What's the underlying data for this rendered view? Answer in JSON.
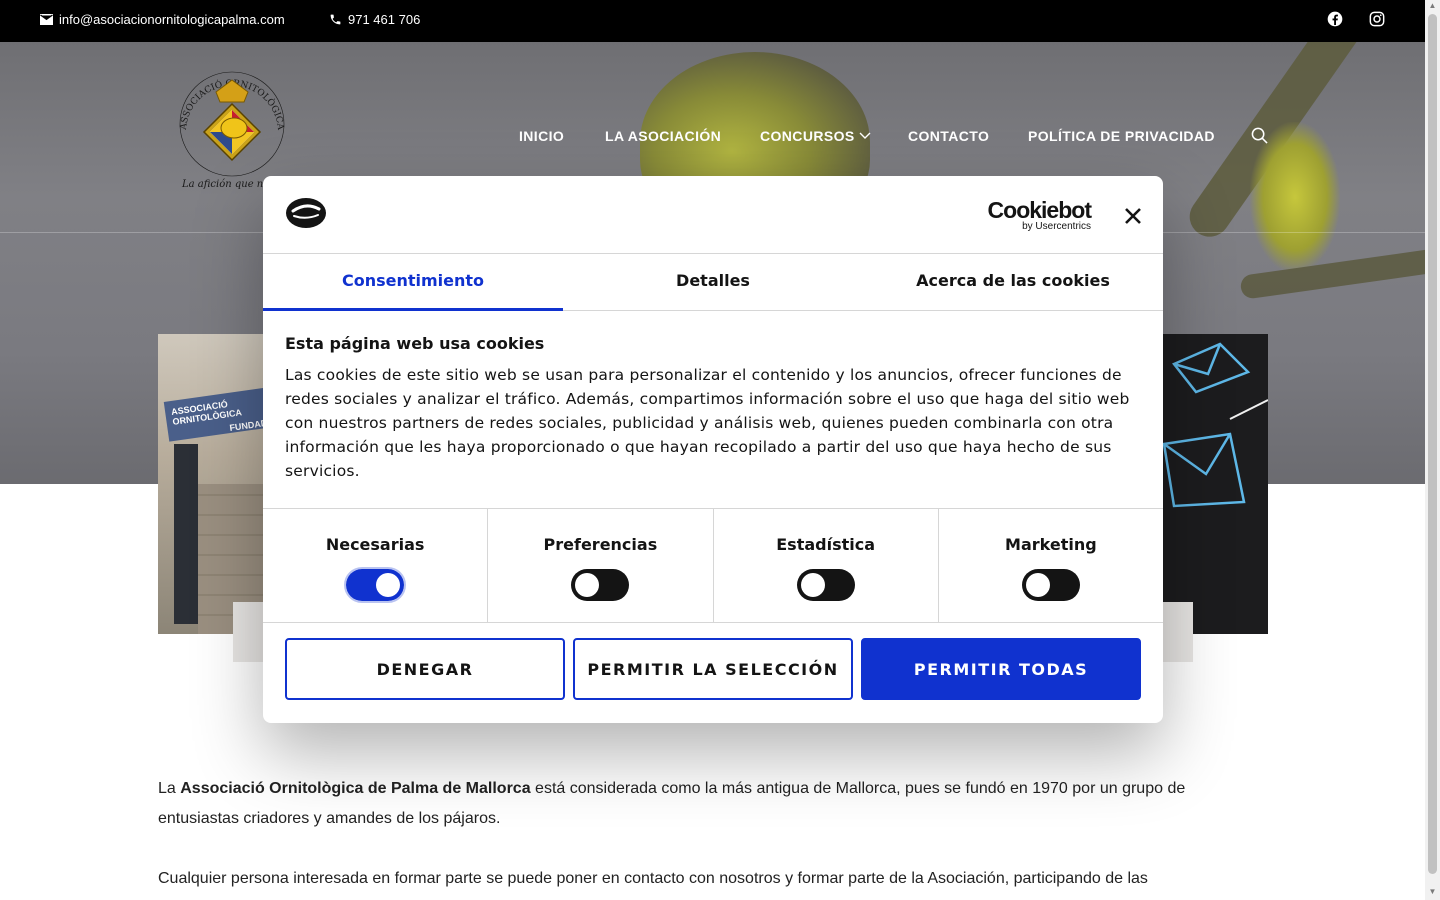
{
  "topbar": {
    "email": "info@asociacionornitologicapalma.com",
    "phone": "971 461 706",
    "social": [
      "facebook-icon",
      "instagram-icon"
    ]
  },
  "logo": {
    "text_top": "ASSOCIACIÓ ORNITOLÒGICA PALMA DE MALLORCA",
    "tagline": "La afición que nos une"
  },
  "nav": {
    "items": [
      "INICIO",
      "LA ASOCIACIÓN",
      "CONCURSOS",
      "CONTACTO",
      "POLÍTICA DE PRIVACIDAD"
    ]
  },
  "hero_sign": {
    "line1": "ASSOCIACIÓ ORNITOLÒGICA",
    "line2": "FUNDADA"
  },
  "cookie_dialog": {
    "brand": "Cookiebot",
    "brand_sub": "by Usercentrics",
    "tabs": [
      "Consentimiento",
      "Detalles",
      "Acerca de las cookies"
    ],
    "active_tab": "Consentimiento",
    "heading": "Esta página web usa cookies",
    "body": "Las cookies de este sitio web se usan para personalizar el contenido y los anuncios, ofrecer funciones de redes sociales y analizar el tráfico. Además, compartimos información sobre el uso que haga del sitio web con nuestros partners de redes sociales, publicidad y análisis web, quienes pueden combinarla con otra información que les haya proporcionado o que hayan recopilado a partir del uso que haya hecho de sus servicios.",
    "toggles": [
      {
        "label": "Necesarias",
        "on": true
      },
      {
        "label": "Preferencias",
        "on": false
      },
      {
        "label": "Estadística",
        "on": false
      },
      {
        "label": "Marketing",
        "on": false
      }
    ],
    "buttons": {
      "deny": "DENEGAR",
      "allow_selection": "PERMITIR LA SELECCIÓN",
      "allow_all": "PERMITIR TODAS"
    },
    "colors": {
      "accent": "#1032cf"
    }
  },
  "content": {
    "p1_prefix": "La ",
    "p1_bold": "Associació Ornitològica de Palma de Mallorca",
    "p1_rest": " está considerada como la más antigua de Mallorca, pues se fundó en 1970 por un grupo de entusiastas criadores y amandes de los pájaros.",
    "p2": "Cualquier persona interesada en formar parte se puede poner en contacto con nosotros y formar parte de la Asociación, participando de las"
  }
}
